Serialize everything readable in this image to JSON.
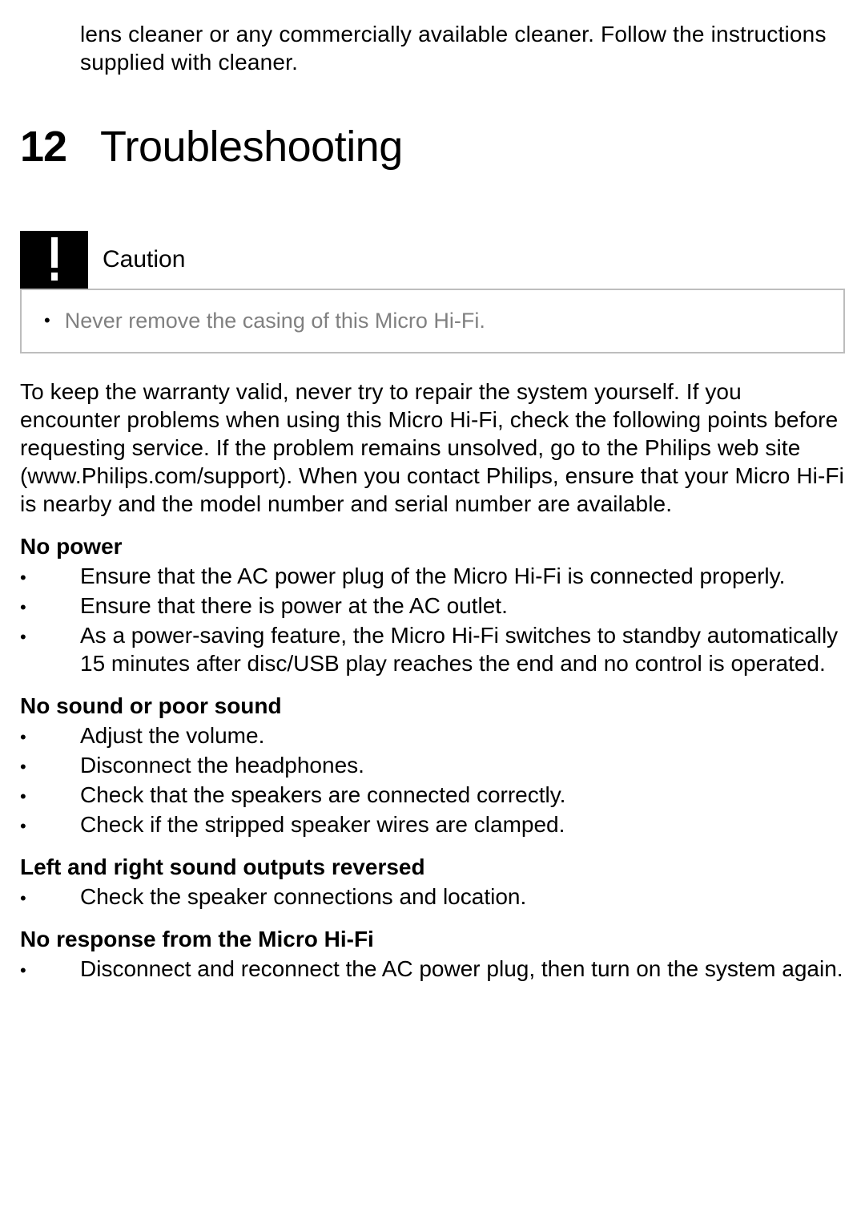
{
  "topFragment": "lens cleaner or any commercially available cleaner. Follow the instructions supplied with cleaner.",
  "chapter": {
    "number": "12",
    "title": "Troubleshooting"
  },
  "caution": {
    "label": "Caution",
    "items": [
      "Never remove the casing of this Micro Hi-Fi."
    ]
  },
  "intro": "To keep the warranty valid, never try to repair the system yourself. If you encounter problems when using this Micro Hi-Fi, check the following points before requesting service. If the problem remains unsolved, go to the Philips web site (www.Philips.com/support). When you contact Philips, ensure that your Micro Hi-Fi is nearby and the model number and serial number are available.",
  "sections": [
    {
      "title": "No power",
      "items": [
        "Ensure that the AC power plug of the Micro Hi-Fi is connected properly.",
        "Ensure that there is power at the AC outlet.",
        "As a power-saving feature, the Micro Hi-Fi switches to standby automatically 15 minutes after disc/USB play reaches the end and no control is operated."
      ]
    },
    {
      "title": "No sound or poor sound",
      "items": [
        "Adjust the volume.",
        "Disconnect the headphones.",
        "Check that the speakers are connected correctly.",
        "Check if the stripped speaker wires are clamped."
      ]
    },
    {
      "title": "Left and right sound outputs reversed",
      "items": [
        "Check the speaker connections and location."
      ]
    },
    {
      "title": "No response from the Micro Hi-Fi",
      "items": [
        "Disconnect and reconnect the AC power plug, then turn on the system again."
      ]
    }
  ]
}
